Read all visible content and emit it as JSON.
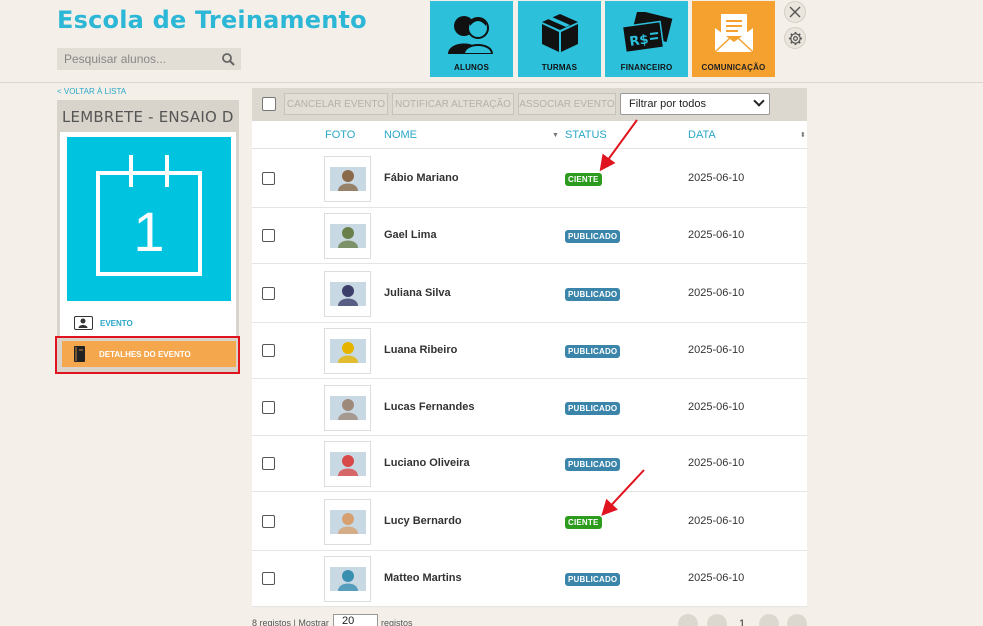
{
  "app": {
    "title": "Escola de Treinamento"
  },
  "search": {
    "placeholder": "Pesquisar alunos..."
  },
  "nav": [
    {
      "label": "ALUNOS",
      "icon": "students-icon"
    },
    {
      "label": "TURMAS",
      "icon": "box-icon"
    },
    {
      "label": "FINANCEIRO",
      "icon": "money-icon"
    },
    {
      "label": "COMUNICAÇÃO",
      "icon": "envelope-icon",
      "active": true
    }
  ],
  "sidebar": {
    "back_link": "< VOLTAR À LISTA",
    "title": "LEMBRETE - ENSAIO D...",
    "calendar_day": "1",
    "items": [
      {
        "label": "EVENTO",
        "icon": "person-card-icon"
      },
      {
        "label": "DETALHES DO EVENTO",
        "icon": "notebook-icon",
        "active": true
      }
    ]
  },
  "toolbar": {
    "cancel": "CANCELAR EVENTO",
    "notify": "NOTIFICAR ALTERAÇÃO",
    "associate": "ASSOCIAR EVENTO",
    "filter": "Filtrar por todos"
  },
  "table": {
    "headers": {
      "photo": "FOTO",
      "name": "NOME",
      "status": "STATUS",
      "date": "DATA"
    },
    "rows": [
      {
        "name": "Fábio Mariano",
        "status": "CIENTE",
        "status_type": "ci",
        "date": "2025-06-10",
        "photo_color": "#8a6a4a"
      },
      {
        "name": "Gael Lima",
        "status": "PUBLICADO",
        "status_type": "pub",
        "date": "2025-06-10",
        "photo_color": "#6b7f4a"
      },
      {
        "name": "Juliana Silva",
        "status": "PUBLICADO",
        "status_type": "pub",
        "date": "2025-06-10",
        "photo_color": "#3d3f6b"
      },
      {
        "name": "Luana Ribeiro",
        "status": "PUBLICADO",
        "status_type": "pub",
        "date": "2025-06-10",
        "photo_color": "#e6b400"
      },
      {
        "name": "Lucas Fernandes",
        "status": "PUBLICADO",
        "status_type": "pub",
        "date": "2025-06-10",
        "photo_color": "#9d8a7a"
      },
      {
        "name": "Luciano Oliveira",
        "status": "PUBLICADO",
        "status_type": "pub",
        "date": "2025-06-10",
        "photo_color": "#d84a4a"
      },
      {
        "name": "Lucy Bernardo",
        "status": "CIENTE",
        "status_type": "ci",
        "date": "2025-06-10",
        "photo_color": "#d6a070"
      },
      {
        "name": "Matteo Martins",
        "status": "PUBLICADO",
        "status_type": "pub",
        "date": "2025-06-10",
        "photo_color": "#3a8fb0"
      }
    ]
  },
  "footer": {
    "records": "8 registos | Mostrar",
    "page_size": "20",
    "suffix": "registos",
    "page": "1"
  },
  "colors": {
    "accent": "#2cb7d6",
    "active_tile": "#f5a130",
    "published": "#3a85a9",
    "aware": "#2c9b1e",
    "highlight": "#e0141e"
  }
}
